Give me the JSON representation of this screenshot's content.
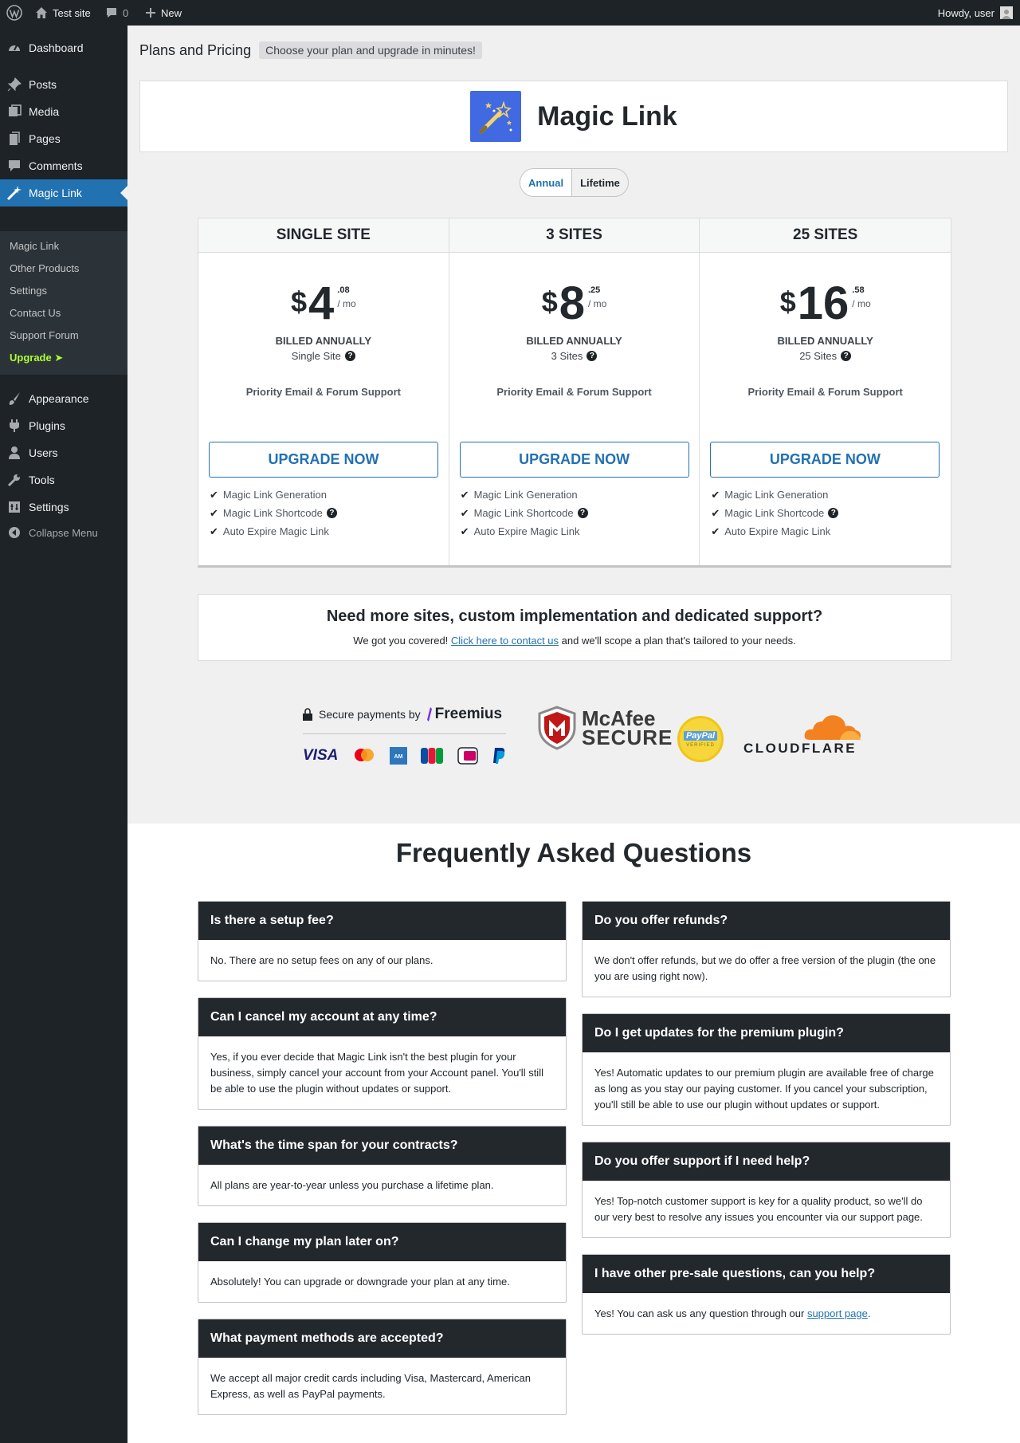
{
  "adminbar": {
    "site_name": "Test site",
    "comments_count": "0",
    "new_label": "New",
    "howdy": "Howdy, user"
  },
  "sidebar": {
    "items": [
      {
        "label": "Dashboard",
        "icon": "dashboard-icon"
      },
      {
        "label": "Posts",
        "icon": "pin-icon"
      },
      {
        "label": "Media",
        "icon": "media-icon"
      },
      {
        "label": "Pages",
        "icon": "pages-icon"
      },
      {
        "label": "Comments",
        "icon": "comment-icon"
      },
      {
        "label": "Magic Link",
        "icon": "magic-wand-icon"
      },
      {
        "label": "Appearance",
        "icon": "brush-icon"
      },
      {
        "label": "Plugins",
        "icon": "plugin-icon"
      },
      {
        "label": "Users",
        "icon": "user-icon"
      },
      {
        "label": "Tools",
        "icon": "wrench-icon"
      },
      {
        "label": "Settings",
        "icon": "settings-icon"
      }
    ],
    "submenu": [
      "Magic Link",
      "Other Products",
      "Settings",
      "Contact Us",
      "Support Forum",
      "Upgrade  ➤"
    ],
    "collapse": "Collapse Menu"
  },
  "header": {
    "title": "Plans and Pricing",
    "subtitle": "Choose your plan and upgrade in minutes!"
  },
  "product": {
    "name": "Magic Link",
    "icon": "magic-wand-icon",
    "color": "#4169e1"
  },
  "billing_toggle": {
    "options": [
      "Annual",
      "Lifetime"
    ],
    "selected": "Annual"
  },
  "plans": [
    {
      "name": "SINGLE SITE",
      "currency": "$",
      "price": "4",
      "cents": ".08",
      "period": "/ mo",
      "billed": "BILLED ANNUALLY",
      "sites": "Single Site",
      "support": "Priority Email & Forum Support",
      "button": "UPGRADE NOW"
    },
    {
      "name": "3 SITES",
      "currency": "$",
      "price": "8",
      "cents": ".25",
      "period": "/ mo",
      "billed": "BILLED ANNUALLY",
      "sites": "3 Sites",
      "support": "Priority Email & Forum Support",
      "button": "UPGRADE NOW"
    },
    {
      "name": "25 SITES",
      "currency": "$",
      "price": "16",
      "cents": ".58",
      "period": "/ mo",
      "billed": "BILLED ANNUALLY",
      "sites": "25 Sites",
      "support": "Priority Email & Forum Support",
      "button": "UPGRADE NOW"
    }
  ],
  "features": [
    "Magic Link Generation",
    "Magic Link Shortcode",
    "Auto Expire Magic Link"
  ],
  "custom": {
    "heading": "Need more sites, custom implementation and dedicated support?",
    "text_before": "We got you covered! ",
    "link": "Click here to contact us",
    "text_after": " and we'll scope a plan that's tailored to your needs."
  },
  "trust": {
    "secure_label": "Secure payments by",
    "freemius": "Freemius",
    "cards": [
      "VISA",
      "mastercard-icon",
      "amex-icon",
      "jcb-icon",
      "ideal-icon",
      "paypal-icon"
    ],
    "mcafee_line1": "McAfee",
    "mcafee_line2": "SECURE",
    "paypal_badge": "PayPal",
    "paypal_verified": "VERIFIED",
    "cloudflare": "CLOUDFLARE"
  },
  "faq": {
    "title": "Frequently Asked Questions",
    "left": [
      {
        "q": "Is there a setup fee?",
        "a": "No. There are no setup fees on any of our plans."
      },
      {
        "q": "Can I cancel my account at any time?",
        "a": "Yes, if you ever decide that Magic Link isn't the best plugin for your business, simply cancel your account from your Account panel. You'll still be able to use the plugin without updates or support."
      },
      {
        "q": "What's the time span for your contracts?",
        "a": "All plans are year-to-year unless you purchase a lifetime plan."
      },
      {
        "q": "Can I change my plan later on?",
        "a": "Absolutely! You can upgrade or downgrade your plan at any time."
      },
      {
        "q": "What payment methods are accepted?",
        "a": "We accept all major credit cards including Visa, Mastercard, American Express, as well as PayPal payments."
      }
    ],
    "right": [
      {
        "q": "Do you offer refunds?",
        "a": "We don't offer refunds, but we do offer a free version of the plugin (the one you are using right now)."
      },
      {
        "q": "Do I get updates for the premium plugin?",
        "a": "Yes! Automatic updates to our premium plugin are available free of charge as long as you stay our paying customer. If you cancel your subscription, you'll still be able to use our plugin without updates or support."
      },
      {
        "q": "Do you offer support if I need help?",
        "a": "Yes! Top-notch customer support is key for a quality product, so we'll do our very best to resolve any issues you encounter via our support page."
      },
      {
        "q": "I have other pre-sale questions, can you help?",
        "a_before": "Yes! You can ask us any question through our ",
        "a_link": "support page",
        "a_after": "."
      }
    ]
  }
}
